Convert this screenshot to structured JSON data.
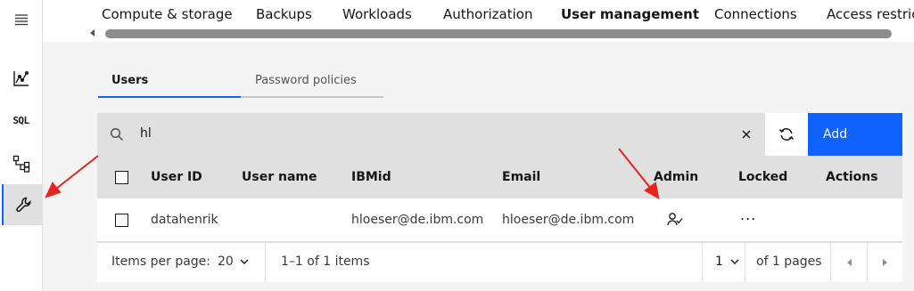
{
  "top_tabs": [
    {
      "label": "Compute & storage"
    },
    {
      "label": "Backups"
    },
    {
      "label": "Workloads"
    },
    {
      "label": "Authorization"
    },
    {
      "label": "User management",
      "selected": true
    },
    {
      "label": "Connections"
    },
    {
      "label": "Access restriction"
    }
  ],
  "sidebar": {
    "items": [
      {
        "icon": "menu-icon"
      },
      {
        "icon": "chart-icon"
      },
      {
        "label": "SQL",
        "icon": "sql-icon"
      },
      {
        "icon": "hierarchy-icon"
      },
      {
        "icon": "wrench-icon",
        "active": true
      }
    ]
  },
  "subtabs": {
    "users": "Users",
    "password_policies": "Password policies"
  },
  "toolbar": {
    "search_value": "hl",
    "add_label": "Add"
  },
  "table": {
    "headers": [
      "User ID",
      "User name",
      "IBMid",
      "Email",
      "Admin",
      "Locked",
      "Actions"
    ],
    "rows": [
      {
        "user_id": "datahenrik",
        "user_name": "",
        "ibmid": "hloeser@de.ibm.com",
        "email": "hloeser@de.ibm.com",
        "admin": true,
        "actions": "..."
      }
    ]
  },
  "pagination": {
    "items_per_page_label": "Items per page:",
    "items_per_page_value": "20",
    "range_text": "1–1 of 1 items",
    "page_value": "1",
    "pages_text": "of 1 pages"
  },
  "colors": {
    "accent": "#0f62fe",
    "annotation_arrow": "#e8231f"
  }
}
